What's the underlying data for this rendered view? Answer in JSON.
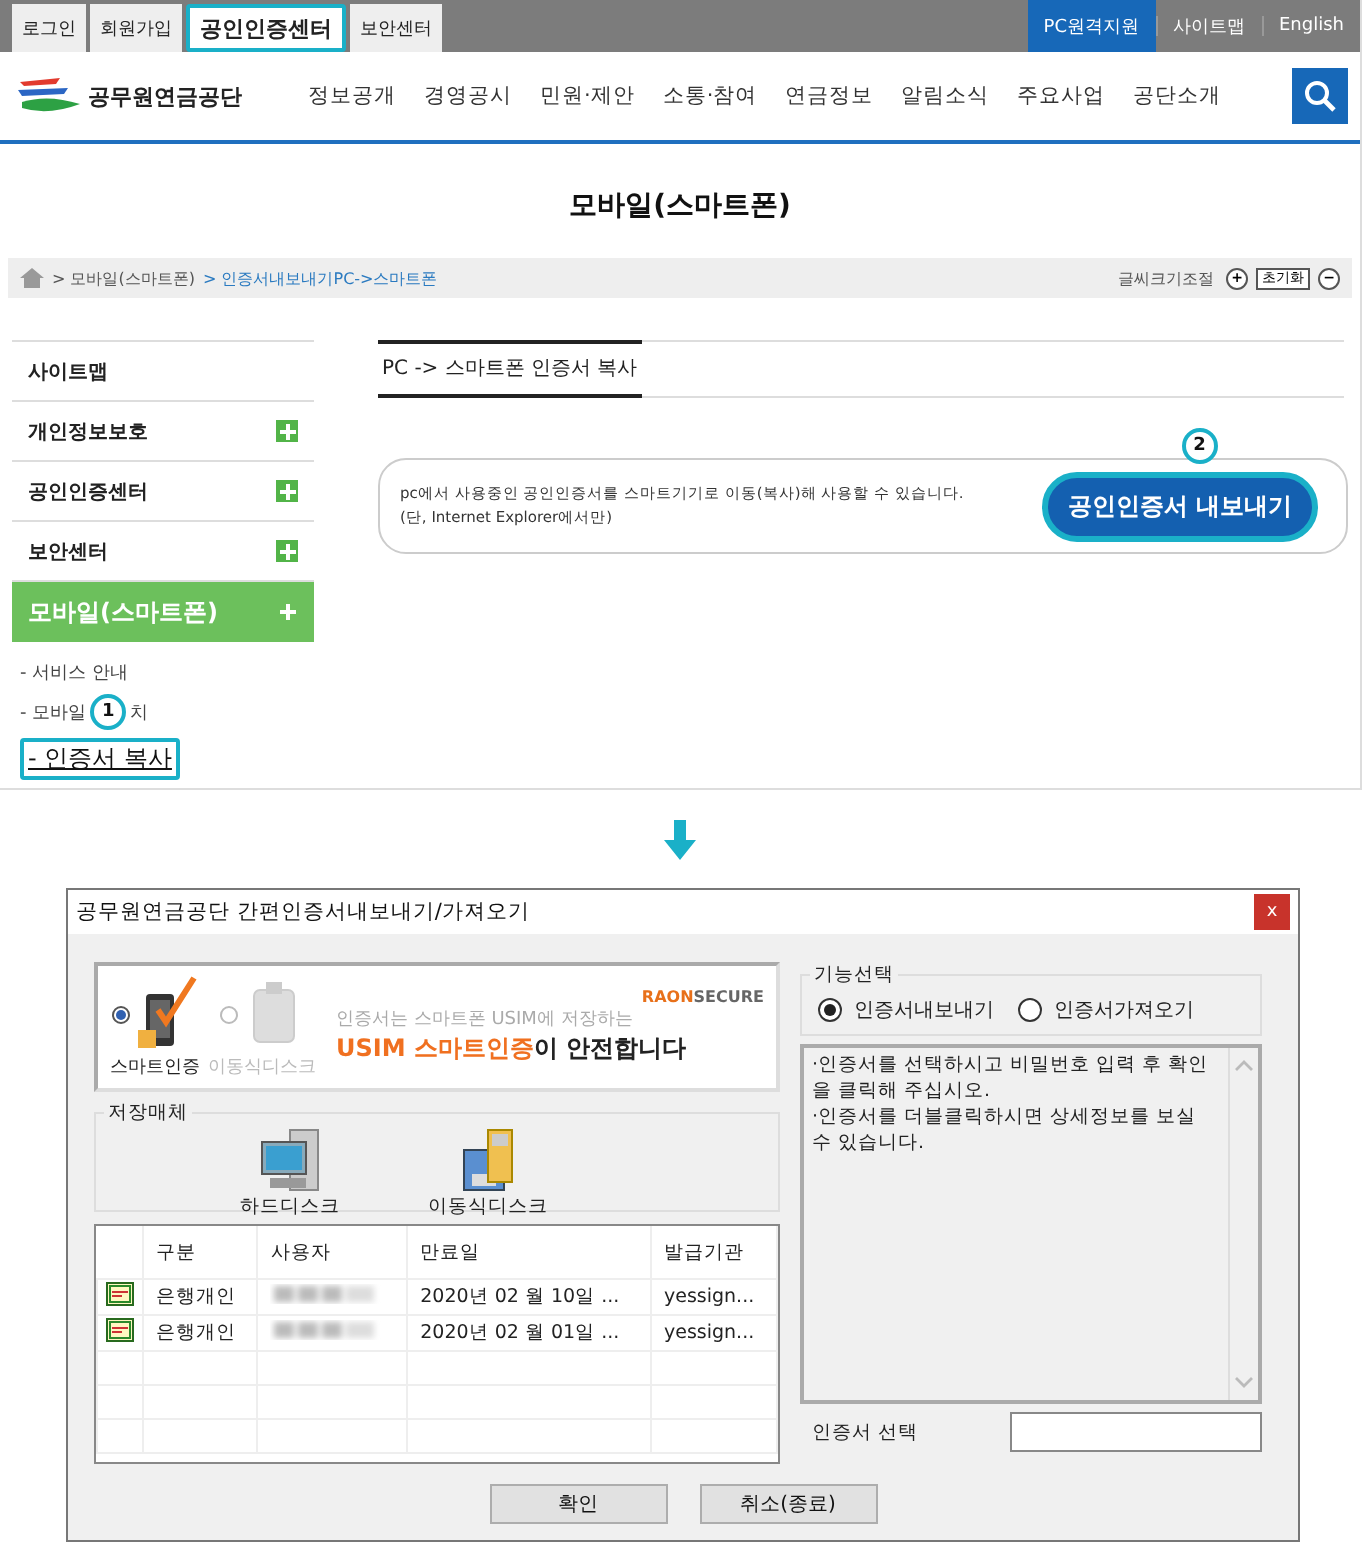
{
  "top_bar": {
    "links": [
      {
        "label": "로그인",
        "selected": false
      },
      {
        "label": "회원가입",
        "selected": false
      },
      {
        "label": "공인인증센터",
        "selected": true
      },
      {
        "label": "보안센터",
        "selected": false
      }
    ],
    "right_links": [
      {
        "label": "PC원격지원",
        "kind": "primary"
      },
      {
        "label": "사이트맵",
        "kind": "plain"
      },
      {
        "label": "English",
        "kind": "plain"
      }
    ]
  },
  "header": {
    "logo_text": "공무원연금공단",
    "menu": [
      "정보공개",
      "경영공시",
      "민원·제안",
      "소통·참여",
      "연금정보",
      "알림소식",
      "주요사업",
      "공단소개"
    ]
  },
  "page_title": "모바일(스마트폰)",
  "breadcrumb": {
    "items": [
      "> 모바일(스마트폰)",
      "> 인증서내보내기PC->스마트폰"
    ],
    "font_size_label": "글씨크기조절",
    "font_buttons": [
      {
        "label": "+",
        "kind": "round"
      },
      {
        "label": "초기화",
        "kind": "box"
      },
      {
        "label": "−",
        "kind": "round"
      }
    ]
  },
  "sidebar": {
    "items": [
      {
        "label": "사이트맵",
        "expandable": false,
        "selected": false
      },
      {
        "label": "개인정보보호",
        "expandable": true,
        "selected": false
      },
      {
        "label": "공인인증센터",
        "expandable": true,
        "selected": false
      },
      {
        "label": "보안센터",
        "expandable": true,
        "selected": false
      },
      {
        "label": "모바일(스마트폰)",
        "expandable": true,
        "selected": true
      }
    ],
    "sub_items": [
      {
        "parts": [
          "- 서비스 안내"
        ],
        "selected": false
      },
      {
        "parts": [
          "- 모바일",
          "치"
        ],
        "selected": false,
        "badge": "1"
      },
      {
        "parts": [
          "- 인증서 복사"
        ],
        "selected": true
      }
    ]
  },
  "content": {
    "section_title": "PC -> 스마트폰 인증서 복사",
    "info_lines": [
      "pc에서 사용중인 공인인증서를 스마트기기로 이동(복사)해 사용할 수 있습니다.",
      "(단, Internet Explorer에서만)"
    ],
    "export_button": "공인인증서 내보내기",
    "export_badge": "2"
  },
  "dialog": {
    "title": "공무원연금공단 간편인증서내보내기/가져오기",
    "close": "x",
    "banner": {
      "brand_a": "RA",
      "brand_b": "ON",
      "brand_c": "SECURE",
      "line1": "인증서는 스마트폰 USIM에 저장하는",
      "line2_highlight": "USIM 스마트인증",
      "line2_rest": "이 안전합니다",
      "options": [
        {
          "label": "스마트인증",
          "selected": true
        },
        {
          "label": "이동식디스크",
          "selected": false
        }
      ]
    },
    "storage": {
      "legend": "저장매체",
      "media": [
        {
          "label": "하드디스크",
          "kind": "hdd"
        },
        {
          "label": "이동식디스크",
          "kind": "usb"
        }
      ]
    },
    "table": {
      "columns": [
        "구분",
        "사용자",
        "만료일",
        "발급기관"
      ],
      "rows": [
        {
          "type": "은행개인",
          "expiry": "2020년 02 월 10일 ...",
          "issuer": "yessign..."
        },
        {
          "type": "은행개인",
          "expiry": "2020년 02 월 01일 ...",
          "issuer": "yessign..."
        }
      ]
    },
    "function": {
      "legend": "기능선택",
      "options": [
        {
          "label": "인증서내보내기",
          "selected": true
        },
        {
          "label": "인증서가져오기",
          "selected": false
        }
      ]
    },
    "message": "·인증서를 선택하시고 비밀번호 입력 후 확인을 클릭해 주십시오.\n·인증서를 더블클릭하시면 상세정보를 보실 수 있습니다.",
    "cert_select_label": "인증서 선택",
    "buttons": [
      "확인",
      "취소(종료)"
    ]
  }
}
